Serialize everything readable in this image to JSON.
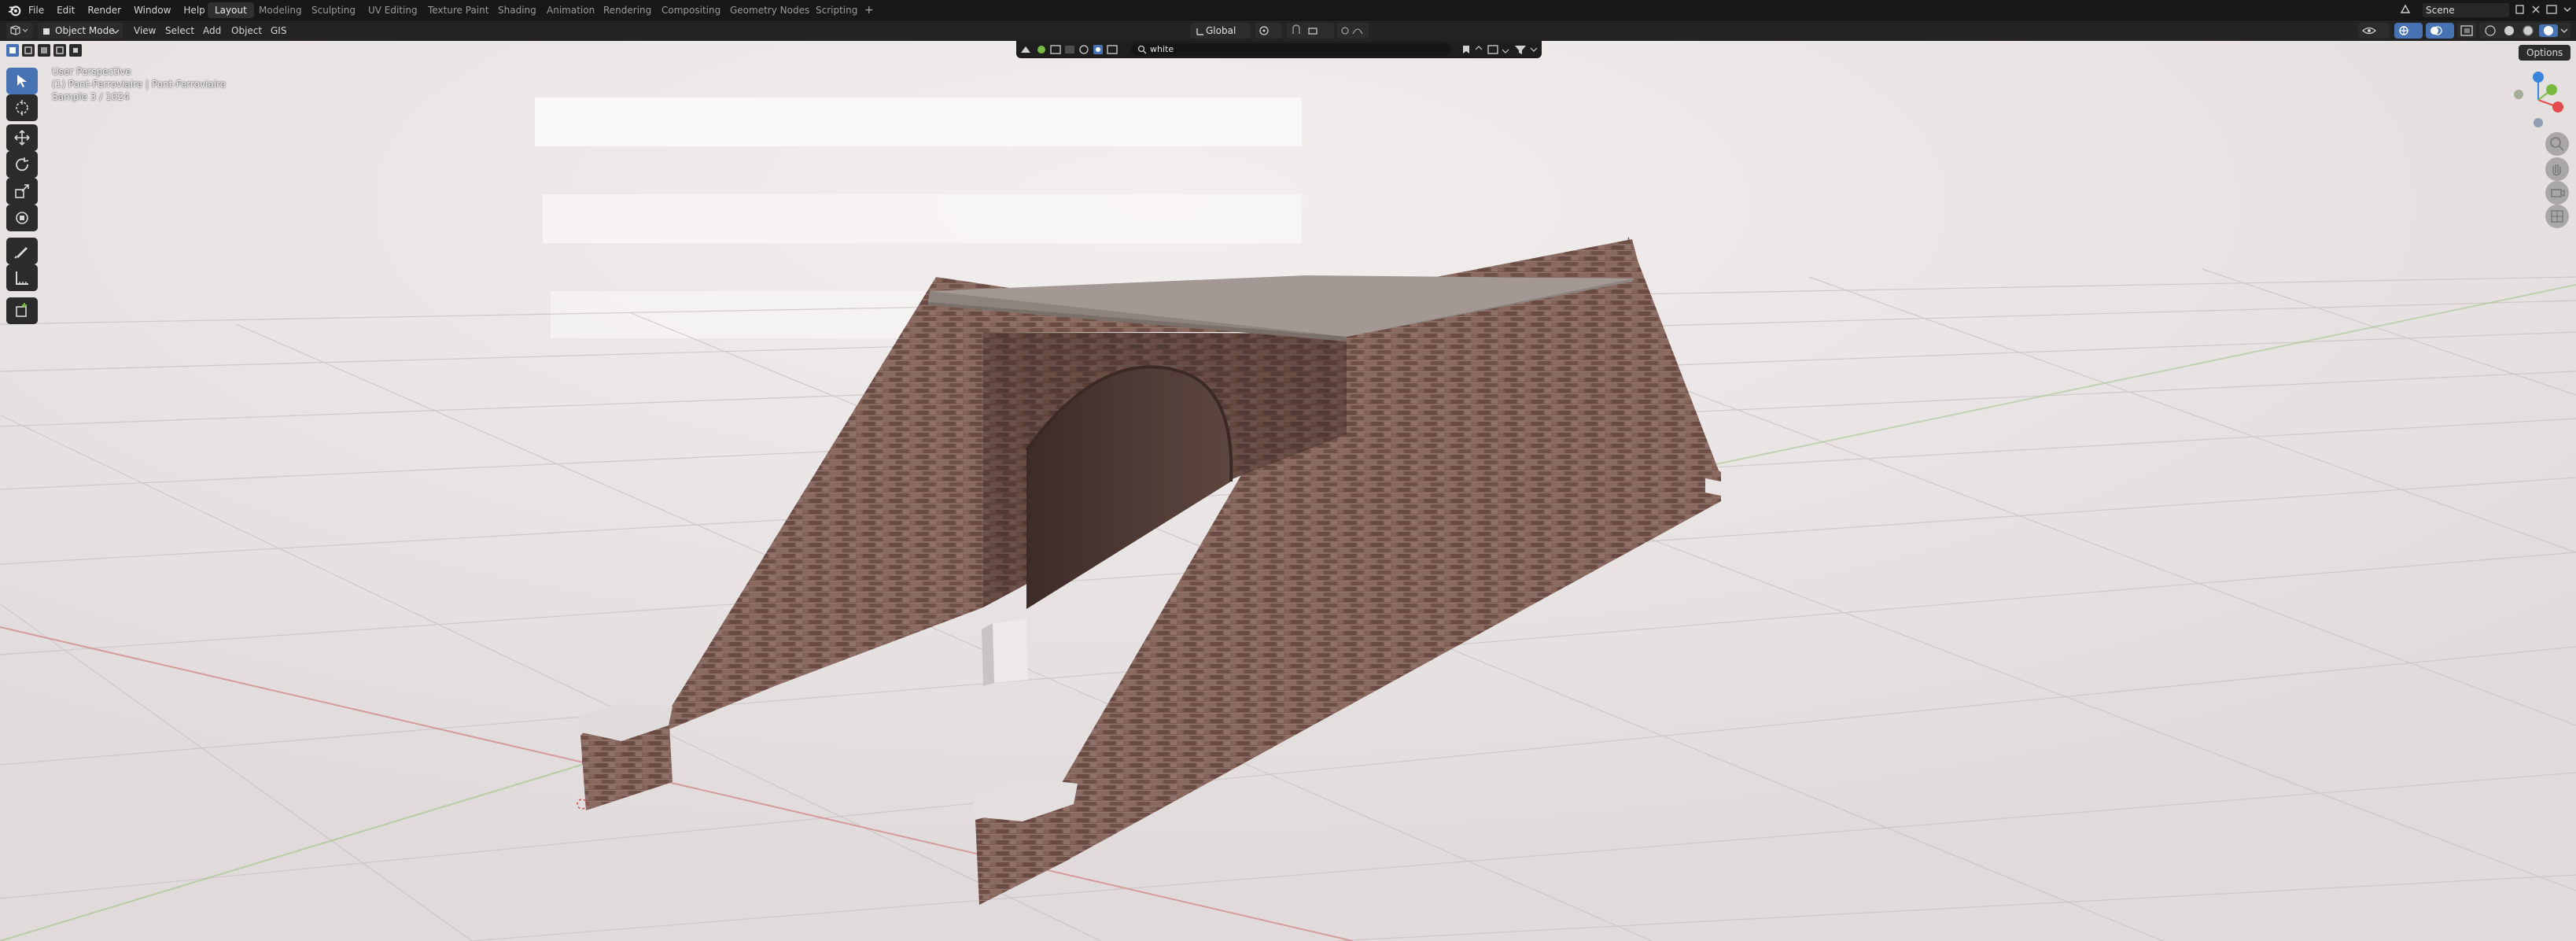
{
  "topbar": {
    "menus": [
      "File",
      "Edit",
      "Render",
      "Window",
      "Help"
    ],
    "workspaces": [
      "Layout",
      "Modeling",
      "Sculpting",
      "UV Editing",
      "Texture Paint",
      "Shading",
      "Animation",
      "Rendering",
      "Compositing",
      "Geometry Nodes",
      "Scripting"
    ],
    "active_workspace": "Layout",
    "add_tab": "+",
    "scene": "Scene"
  },
  "header": {
    "mode": "Object Mode",
    "menus": [
      "View",
      "Select",
      "Add",
      "Object",
      "GIS"
    ],
    "orientation": "Global",
    "options": "Options"
  },
  "search": {
    "value": "white"
  },
  "viewport": {
    "line1": "User Perspective",
    "line2": "(1) Pont-Ferroviaire | Pont-Ferroviaire",
    "line3": "Sample 3 / 1024"
  },
  "colors": {
    "accent": "#4772b3",
    "x_axis": "#e54b4b",
    "y_axis": "#7ab93f",
    "z_axis": "#3b85de"
  },
  "toolbar_icons": [
    "select-box-icon",
    "cursor-icon",
    "move-icon",
    "rotate-icon",
    "scale-icon",
    "transform-icon",
    "annotate-icon",
    "measure-icon",
    "add-cube-icon"
  ]
}
